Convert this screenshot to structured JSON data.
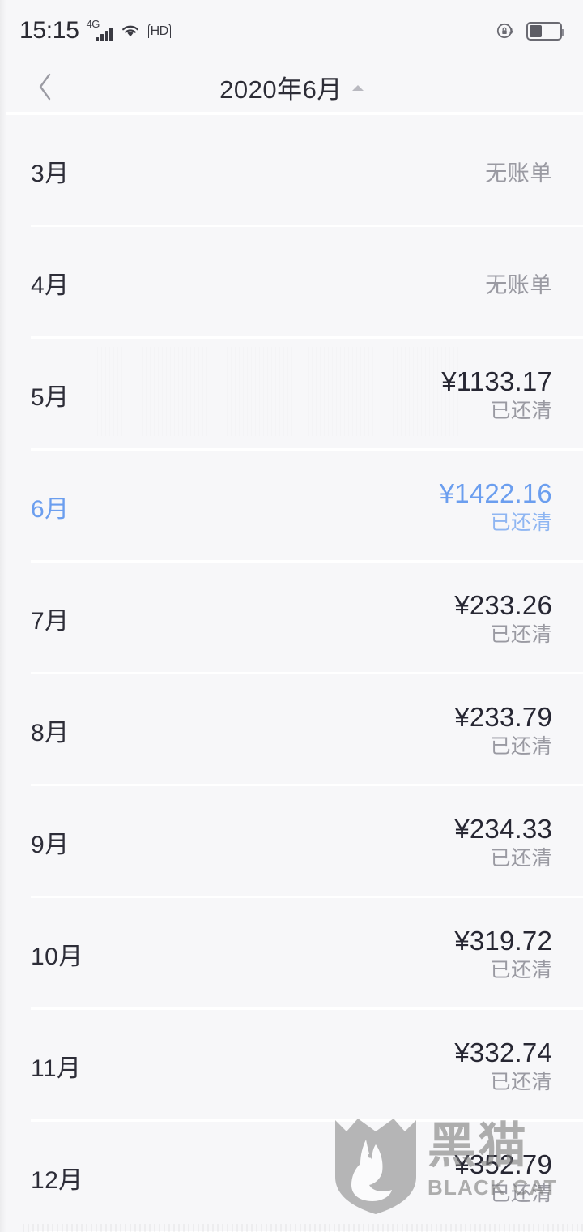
{
  "status_bar": {
    "time": "15:15",
    "network_label": "4G",
    "hd_label": "HD",
    "icons": [
      "signal-icon",
      "wifi-icon",
      "hd-icon",
      "rotation-lock-icon",
      "battery-icon"
    ],
    "battery_percent": 38
  },
  "nav": {
    "back_label": "‹",
    "title": "2020年6月",
    "caret": "caret-up"
  },
  "colors": {
    "accent_blue": "#6b9eef",
    "text_primary": "#272733",
    "text_muted": "#9a9aa2",
    "background": "#f7f7f9"
  },
  "list": {
    "rows": [
      {
        "month": "3月",
        "amount": "",
        "status": "无账单",
        "no_bill": true,
        "selected": false
      },
      {
        "month": "4月",
        "amount": "",
        "status": "无账单",
        "no_bill": true,
        "selected": false
      },
      {
        "month": "5月",
        "amount": "¥1133.17",
        "status": "已还清",
        "no_bill": false,
        "selected": false
      },
      {
        "month": "6月",
        "amount": "¥1422.16",
        "status": "已还清",
        "no_bill": false,
        "selected": true
      },
      {
        "month": "7月",
        "amount": "¥233.26",
        "status": "已还清",
        "no_bill": false,
        "selected": false
      },
      {
        "month": "8月",
        "amount": "¥233.79",
        "status": "已还清",
        "no_bill": false,
        "selected": false
      },
      {
        "month": "9月",
        "amount": "¥234.33",
        "status": "已还清",
        "no_bill": false,
        "selected": false
      },
      {
        "month": "10月",
        "amount": "¥319.72",
        "status": "已还清",
        "no_bill": false,
        "selected": false
      },
      {
        "month": "11月",
        "amount": "¥332.74",
        "status": "已还清",
        "no_bill": false,
        "selected": false
      },
      {
        "month": "12月",
        "amount": "¥352.79",
        "status": "已还清",
        "no_bill": false,
        "selected": false
      }
    ]
  },
  "watermark": {
    "cn": "黑猫",
    "en": "BLACK CAT"
  }
}
